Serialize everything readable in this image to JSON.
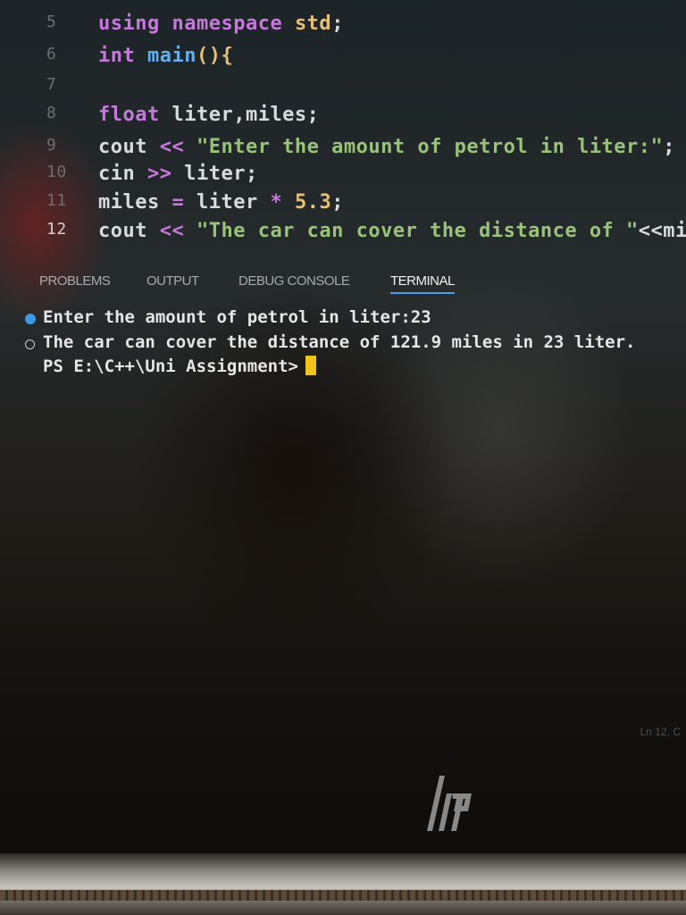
{
  "editor": {
    "lines": [
      {
        "num": "5",
        "parts": [
          {
            "t": "using",
            "c": "kw"
          },
          {
            "t": " namespace ",
            "c": "kw"
          },
          {
            "t": "std",
            "c": "type"
          },
          {
            "t": ";",
            "c": "plain"
          }
        ]
      },
      {
        "num": "6",
        "parts": [
          {
            "t": "int",
            "c": "kw"
          },
          {
            "t": " ",
            "c": "plain"
          },
          {
            "t": "main",
            "c": "fn"
          },
          {
            "t": "(){",
            "c": "type"
          }
        ]
      },
      {
        "num": "7",
        "parts": []
      },
      {
        "num": "8",
        "parts": [
          {
            "t": "float",
            "c": "kw"
          },
          {
            "t": " liter,miles;",
            "c": "plain"
          }
        ]
      },
      {
        "num": "9",
        "parts": [
          {
            "t": "cout",
            "c": "plain"
          },
          {
            "t": " << ",
            "c": "op"
          },
          {
            "t": "\"Enter the amount of petrol in liter:\"",
            "c": "str"
          },
          {
            "t": ";",
            "c": "plain"
          }
        ]
      },
      {
        "num": "10",
        "parts": [
          {
            "t": "cin",
            "c": "plain"
          },
          {
            "t": " >> ",
            "c": "op"
          },
          {
            "t": "liter;",
            "c": "plain"
          }
        ]
      },
      {
        "num": "11",
        "parts": [
          {
            "t": "miles",
            "c": "plain"
          },
          {
            "t": " = ",
            "c": "op"
          },
          {
            "t": "liter ",
            "c": "plain"
          },
          {
            "t": "* ",
            "c": "op"
          },
          {
            "t": "5.3",
            "c": "num"
          },
          {
            "t": ";",
            "c": "plain"
          }
        ]
      },
      {
        "num": "12",
        "parts": [
          {
            "t": "cout",
            "c": "plain"
          },
          {
            "t": " << ",
            "c": "op"
          },
          {
            "t": "\"The car can cover the distance of \"",
            "c": "str"
          },
          {
            "t": "<<miles<",
            "c": "plain"
          }
        ]
      }
    ]
  },
  "panel": {
    "tabs": [
      {
        "label": "PROBLEMS"
      },
      {
        "label": "OUTPUT"
      },
      {
        "label": "DEBUG CONSOLE"
      },
      {
        "label": "TERMINAL"
      }
    ],
    "active_tab": "TERMINAL"
  },
  "terminal": {
    "lines": [
      "Enter the amount of petrol in liter:23",
      "The car can cover the distance of 121.9 miles in 23 liter.",
      "PS E:\\C++\\Uni Assignment>"
    ]
  },
  "statusbar": {
    "position": "Ln 12, C"
  },
  "icons": {
    "brand_logo": "hp-logo-icon"
  },
  "colors": {
    "accent": "#4c9be8",
    "cursor": "#f0c419"
  }
}
